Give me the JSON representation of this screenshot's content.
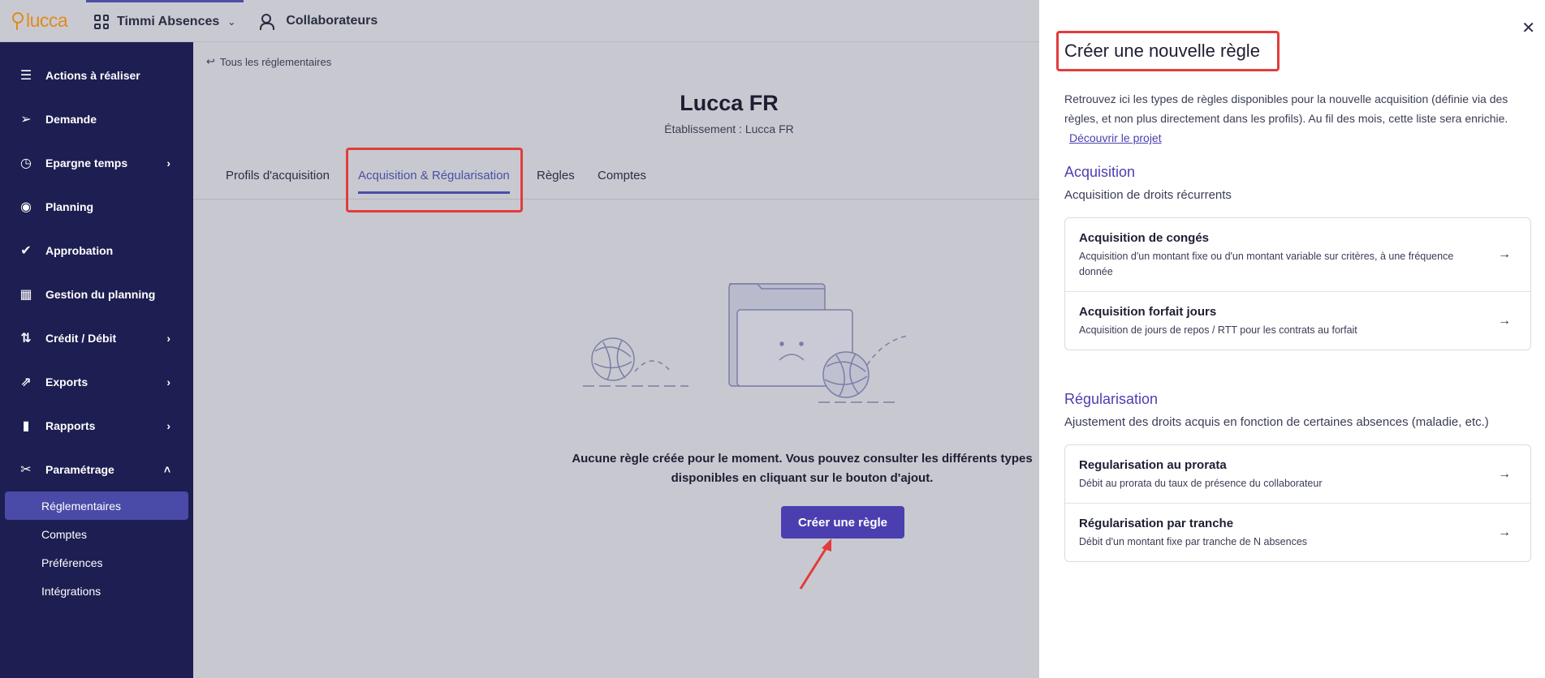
{
  "topbar": {
    "logo_text": "lucca",
    "app_name": "Timmi Absences",
    "collaborators": "Collaborateurs"
  },
  "sidebar": {
    "items": [
      {
        "label": "Actions à réaliser",
        "icon": "checklist-icon",
        "has_arrow": false
      },
      {
        "label": "Demande",
        "icon": "send-icon",
        "has_arrow": false
      },
      {
        "label": "Epargne temps",
        "icon": "clock-icon",
        "has_arrow": true
      },
      {
        "label": "Planning",
        "icon": "eye-icon",
        "has_arrow": false
      },
      {
        "label": "Approbation",
        "icon": "check-icon",
        "has_arrow": false
      },
      {
        "label": "Gestion du planning",
        "icon": "calendar-icon",
        "has_arrow": false
      },
      {
        "label": "Crédit / Débit",
        "icon": "sort-arrows-icon",
        "has_arrow": true
      },
      {
        "label": "Exports",
        "icon": "external-link-icon",
        "has_arrow": true
      },
      {
        "label": "Rapports",
        "icon": "bar-chart-icon",
        "has_arrow": true
      },
      {
        "label": "Paramétrage",
        "icon": "tools-icon",
        "has_arrow": true
      }
    ],
    "sub_items": [
      "Réglementaires",
      "Comptes",
      "Préférences",
      "Intégrations"
    ]
  },
  "main": {
    "back_link": "Tous les réglementaires",
    "title": "Lucca FR",
    "subtitle": "Établissement : Lucca FR",
    "tabs": [
      "Profils d'acquisition",
      "Acquisition & Régularisation",
      "Règles",
      "Comptes"
    ],
    "empty_message": "Aucune règle créée pour le moment. Vous pouvez consulter les différents types disponibles en cliquant sur le bouton d'ajout.",
    "cta_label": "Créer une règle"
  },
  "panel": {
    "title": "Créer une nouvelle règle",
    "description": "Retrouvez ici les types de règles disponibles pour la nouvelle acquisition (définie via des règles, et non plus directement dans les profils). Au fil des mois, cette liste sera enrichie.",
    "discover_link": "Découvrir le projet",
    "acquisition": {
      "title": "Acquisition",
      "subtitle": "Acquisition de droits récurrents",
      "rows": [
        {
          "title": "Acquisition de congés",
          "desc": "Acquisition d'un montant fixe ou d'un montant variable sur critères, à une fréquence donnée"
        },
        {
          "title": "Acquisition forfait jours",
          "desc": "Acquisition de jours de repos / RTT pour les contrats au forfait"
        }
      ]
    },
    "regularisation": {
      "title": "Régularisation",
      "subtitle": "Ajustement des droits acquis en fonction de certaines absences (maladie, etc.)",
      "rows": [
        {
          "title": "Regularisation au prorata",
          "desc": "Débit au prorata du taux de présence du collaborateur"
        },
        {
          "title": "Régularisation par tranche",
          "desc": "Débit d'un montant fixe par tranche de N absences"
        }
      ]
    }
  },
  "colors": {
    "sidebar_bg": "#1d1e51",
    "accent": "#4b3fb0",
    "highlight": "#e23c3c",
    "logo": "#e08a1e"
  }
}
